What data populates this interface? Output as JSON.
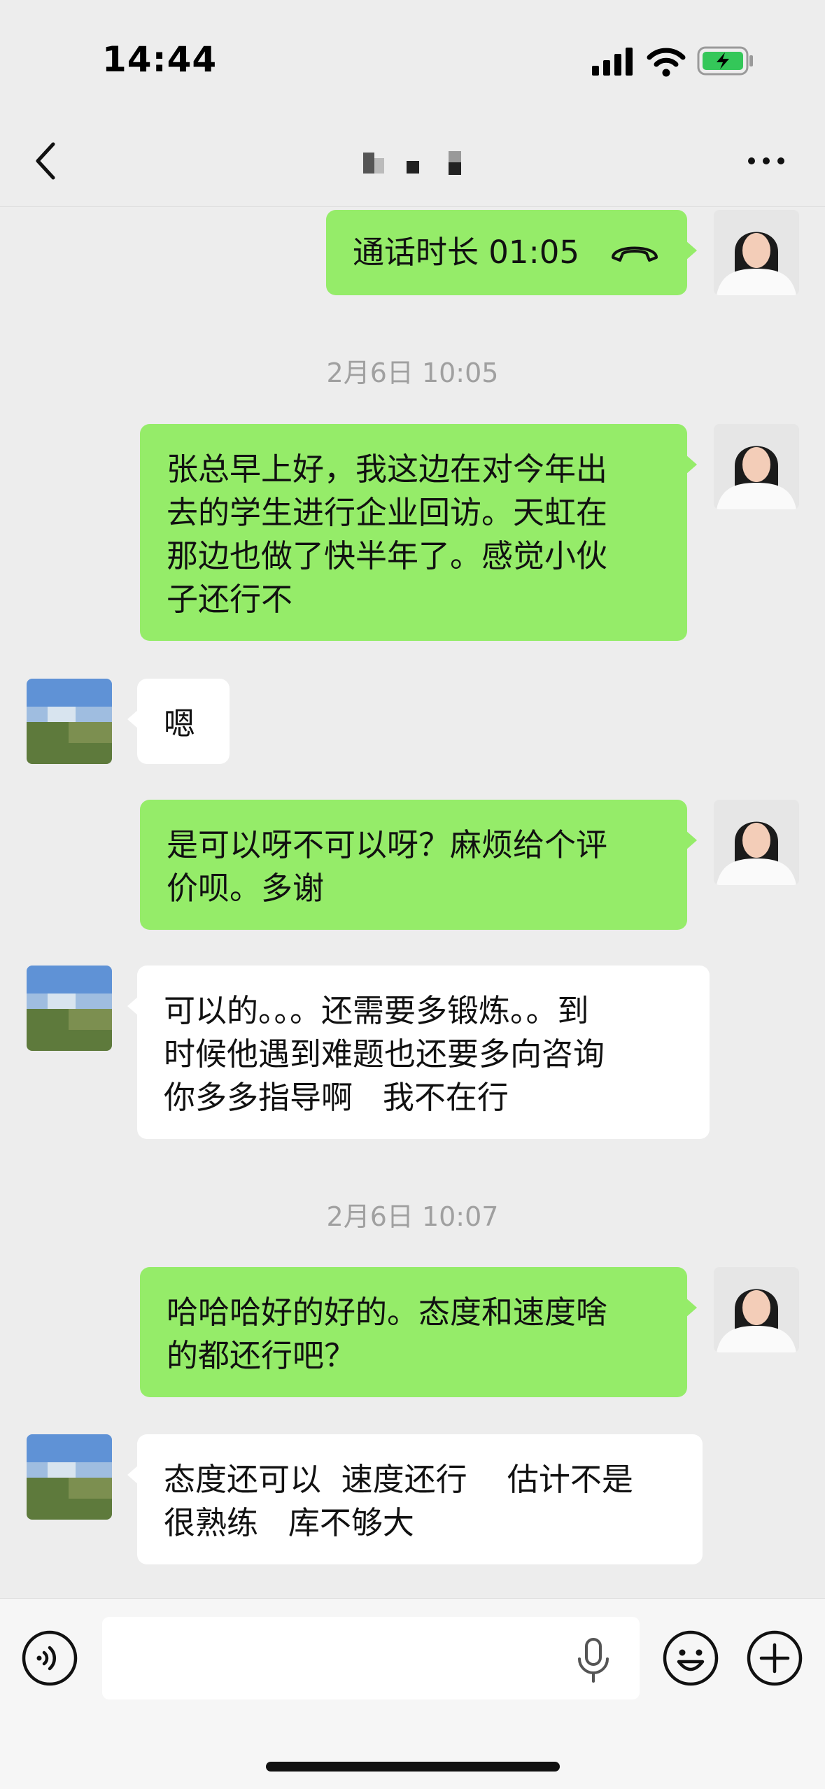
{
  "status_bar": {
    "time": "14:44",
    "icons": [
      "signal-icon",
      "wifi-icon",
      "battery-charging-icon"
    ]
  },
  "nav": {
    "back_icon": "chevron-left-icon",
    "contact_name_pixelated": true,
    "more_icon": "ellipsis-icon"
  },
  "chat": {
    "call": {
      "text": "通话时长 01:05",
      "icon": "phone-hangup-icon",
      "direction": "outgoing"
    },
    "timestamps": [
      "2月6日 10:05",
      "2月6日 10:07"
    ],
    "messages": [
      {
        "direction": "outgoing",
        "lines": [
          "张总早上好，我这边在对今年出",
          "去的学生进行企业回访。天虹在",
          "那边也做了快半年了。感觉小伙",
          "子还行不"
        ]
      },
      {
        "direction": "incoming",
        "lines": [
          "嗯"
        ]
      },
      {
        "direction": "outgoing",
        "lines": [
          "是可以呀不可以呀？麻烦给个评",
          "价呗。多谢"
        ]
      },
      {
        "direction": "incoming",
        "lines": [
          "可以的。。。还需要多锻炼。。到",
          "时候他遇到难题也还要多向咨询",
          "你多多指导啊   我不在行"
        ]
      },
      {
        "direction": "outgoing",
        "lines": [
          "哈哈哈好的好的。态度和速度啥",
          "的都还行吧？"
        ]
      },
      {
        "direction": "incoming",
        "lines": [
          "态度还可以  速度还行    估计不是",
          "很熟练   库不够大"
        ]
      }
    ]
  },
  "input_bar": {
    "voice_icon": "voice-toggle-icon",
    "placeholder": "",
    "mic_icon": "microphone-icon",
    "emoji_icon": "emoji-icon",
    "plus_icon": "plus-icon"
  },
  "colors": {
    "outgoing_bubble": "#95ec69",
    "incoming_bubble": "#ffffff",
    "background": "#ededed",
    "timestamp": "#a0a0a0",
    "battery": "#34c759"
  }
}
